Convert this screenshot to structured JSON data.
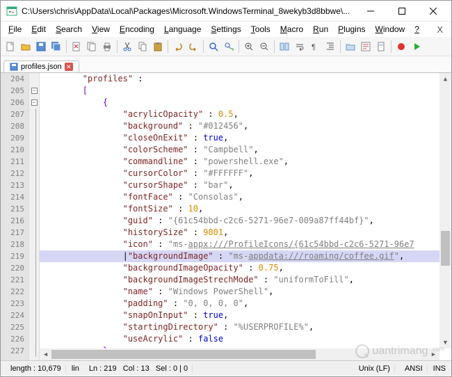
{
  "titlebar": {
    "text": "C:\\Users\\chris\\AppData\\Local\\Packages\\Microsoft.WindowsTerminal_8wekyb3d8bbwe\\..."
  },
  "menu": {
    "items": [
      "File",
      "Edit",
      "Search",
      "View",
      "Encoding",
      "Language",
      "Settings",
      "Tools",
      "Macro",
      "Run",
      "Plugins",
      "Window",
      "?"
    ]
  },
  "tab": {
    "label": "profiles.json"
  },
  "gutter": {
    "start": 204,
    "count": 24
  },
  "code": {
    "rows": [
      {
        "n": 204,
        "segs": [
          {
            "t": "        "
          },
          {
            "t": "\"profiles\"",
            "c": "key"
          },
          {
            "t": " : "
          }
        ]
      },
      {
        "n": 205,
        "segs": [
          {
            "t": "        "
          },
          {
            "t": "[",
            "c": "brak"
          }
        ]
      },
      {
        "n": 206,
        "segs": [
          {
            "t": "            "
          },
          {
            "t": "{",
            "c": "brak"
          }
        ]
      },
      {
        "n": 207,
        "segs": [
          {
            "t": "                "
          },
          {
            "t": "\"acrylicOpacity\"",
            "c": "key"
          },
          {
            "t": " : "
          },
          {
            "t": "0.5",
            "c": "num"
          },
          {
            "t": ",",
            "c": "punc"
          }
        ]
      },
      {
        "n": 208,
        "segs": [
          {
            "t": "                "
          },
          {
            "t": "\"background\"",
            "c": "key"
          },
          {
            "t": " : "
          },
          {
            "t": "\"#012456\"",
            "c": "str"
          },
          {
            "t": ",",
            "c": "punc"
          }
        ]
      },
      {
        "n": 209,
        "segs": [
          {
            "t": "                "
          },
          {
            "t": "\"closeOnExit\"",
            "c": "key"
          },
          {
            "t": " : "
          },
          {
            "t": "true",
            "c": "bool"
          },
          {
            "t": ",",
            "c": "punc"
          }
        ]
      },
      {
        "n": 210,
        "segs": [
          {
            "t": "                "
          },
          {
            "t": "\"colorScheme\"",
            "c": "key"
          },
          {
            "t": " : "
          },
          {
            "t": "\"Campbell\"",
            "c": "str"
          },
          {
            "t": ",",
            "c": "punc"
          }
        ]
      },
      {
        "n": 211,
        "segs": [
          {
            "t": "                "
          },
          {
            "t": "\"commandline\"",
            "c": "key"
          },
          {
            "t": " : "
          },
          {
            "t": "\"powershell.exe\"",
            "c": "str"
          },
          {
            "t": ",",
            "c": "punc"
          }
        ]
      },
      {
        "n": 212,
        "segs": [
          {
            "t": "                "
          },
          {
            "t": "\"cursorColor\"",
            "c": "key"
          },
          {
            "t": " : "
          },
          {
            "t": "\"#FFFFFF\"",
            "c": "str"
          },
          {
            "t": ",",
            "c": "punc"
          }
        ]
      },
      {
        "n": 213,
        "segs": [
          {
            "t": "                "
          },
          {
            "t": "\"cursorShape\"",
            "c": "key"
          },
          {
            "t": " : "
          },
          {
            "t": "\"bar\"",
            "c": "str"
          },
          {
            "t": ",",
            "c": "punc"
          }
        ]
      },
      {
        "n": 214,
        "segs": [
          {
            "t": "                "
          },
          {
            "t": "\"fontFace\"",
            "c": "key"
          },
          {
            "t": " : "
          },
          {
            "t": "\"Consolas\"",
            "c": "str"
          },
          {
            "t": ",",
            "c": "punc"
          }
        ]
      },
      {
        "n": 215,
        "segs": [
          {
            "t": "                "
          },
          {
            "t": "\"fontSize\"",
            "c": "key"
          },
          {
            "t": " : "
          },
          {
            "t": "10",
            "c": "num"
          },
          {
            "t": ",",
            "c": "punc"
          }
        ]
      },
      {
        "n": 216,
        "segs": [
          {
            "t": "                "
          },
          {
            "t": "\"guid\"",
            "c": "key"
          },
          {
            "t": " : "
          },
          {
            "t": "\"{61c54bbd-c2c6-5271-96e7-009a87ff44bf}\"",
            "c": "str"
          },
          {
            "t": ",",
            "c": "punc"
          }
        ]
      },
      {
        "n": 217,
        "segs": [
          {
            "t": "                "
          },
          {
            "t": "\"historySize\"",
            "c": "key"
          },
          {
            "t": " : "
          },
          {
            "t": "9001",
            "c": "num"
          },
          {
            "t": ",",
            "c": "punc"
          }
        ]
      },
      {
        "n": 218,
        "segs": [
          {
            "t": "                "
          },
          {
            "t": "\"icon\"",
            "c": "key"
          },
          {
            "t": " : "
          },
          {
            "t": "\"ms-",
            "c": "str"
          },
          {
            "t": "appx:///ProfileIcons/{61c54bbd-c2c6-5271-96e7",
            "c": "lnk"
          }
        ]
      },
      {
        "n": 219,
        "hl": "sel",
        "segs": [
          {
            "t": "                |"
          },
          {
            "t": "\"backgroundImage\"",
            "c": "key"
          },
          {
            "t": " : "
          },
          {
            "t": "\"ms-",
            "c": "str"
          },
          {
            "t": "appdata:///roaming/coffee.gif",
            "c": "lnk"
          },
          {
            "t": "\"",
            "c": "str"
          },
          {
            "t": ",",
            "c": "punc"
          }
        ]
      },
      {
        "n": 220,
        "segs": [
          {
            "t": "                "
          },
          {
            "t": "\"backgroundImageOpacity\"",
            "c": "key"
          },
          {
            "t": " : "
          },
          {
            "t": "0.75",
            "c": "num"
          },
          {
            "t": ",",
            "c": "punc"
          }
        ]
      },
      {
        "n": 221,
        "segs": [
          {
            "t": "                "
          },
          {
            "t": "\"backgroundImageStrechMode\"",
            "c": "key"
          },
          {
            "t": " : "
          },
          {
            "t": "\"uniformToFill\"",
            "c": "str"
          },
          {
            "t": ",",
            "c": "punc"
          }
        ]
      },
      {
        "n": 222,
        "segs": [
          {
            "t": "                "
          },
          {
            "t": "\"name\"",
            "c": "key"
          },
          {
            "t": " : "
          },
          {
            "t": "\"Windows PowerShell\"",
            "c": "str"
          },
          {
            "t": ",",
            "c": "punc"
          }
        ]
      },
      {
        "n": 223,
        "segs": [
          {
            "t": "                "
          },
          {
            "t": "\"padding\"",
            "c": "key"
          },
          {
            "t": " : "
          },
          {
            "t": "\"0, 0, 0, 0\"",
            "c": "str"
          },
          {
            "t": ",",
            "c": "punc"
          }
        ]
      },
      {
        "n": 224,
        "segs": [
          {
            "t": "                "
          },
          {
            "t": "\"snapOnInput\"",
            "c": "key"
          },
          {
            "t": " : "
          },
          {
            "t": "true",
            "c": "bool"
          },
          {
            "t": ",",
            "c": "punc"
          }
        ]
      },
      {
        "n": 225,
        "segs": [
          {
            "t": "                "
          },
          {
            "t": "\"startingDirectory\"",
            "c": "key"
          },
          {
            "t": " : "
          },
          {
            "t": "\"%USERPROFILE%\"",
            "c": "str"
          },
          {
            "t": ",",
            "c": "punc"
          }
        ]
      },
      {
        "n": 226,
        "segs": [
          {
            "t": "                "
          },
          {
            "t": "\"useAcrylic\"",
            "c": "key"
          },
          {
            "t": " : "
          },
          {
            "t": "false",
            "c": "bool"
          }
        ]
      },
      {
        "n": 227,
        "segs": [
          {
            "t": "            "
          },
          {
            "t": "}",
            "c": "brak"
          },
          {
            "t": ",",
            "c": "punc"
          }
        ]
      }
    ]
  },
  "status": {
    "length_label": "length :",
    "length": "10,679",
    "lines_label": "lin",
    "ln_label": "Ln :",
    "ln": "219",
    "col_label": "Col :",
    "col": "13",
    "sel_label": "Sel :",
    "sel": "0 | 0",
    "eol": "Unix (LF)",
    "enc": "ANSI",
    "ins": "INS"
  },
  "watermark": "uantrimang"
}
